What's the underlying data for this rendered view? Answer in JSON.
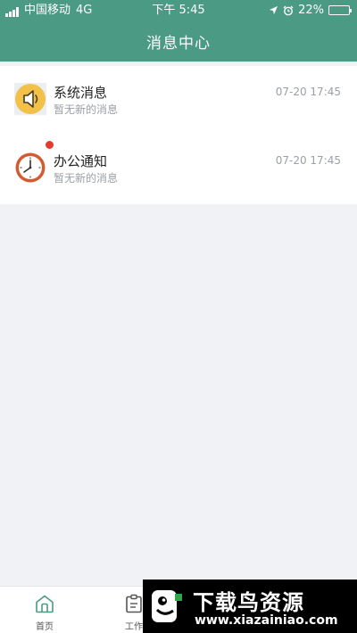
{
  "status_bar": {
    "carrier": "中国移动",
    "network": "4G",
    "time": "下午 5:45",
    "battery": "22%",
    "battery_level": 0.22
  },
  "header": {
    "title": "消息中心"
  },
  "messages": [
    {
      "title": "系统消息",
      "subtitle": "暂无新的消息",
      "time": "07-20 17:45",
      "icon": "speaker-icon",
      "unread": false
    },
    {
      "title": "办公通知",
      "subtitle": "暂无新的消息",
      "time": "07-20 17:45",
      "icon": "clock-icon",
      "unread": true
    }
  ],
  "tabbar": {
    "items": [
      {
        "label": "首页",
        "icon": "home-icon"
      },
      {
        "label": "工作",
        "icon": "clipboard-icon"
      }
    ]
  },
  "watermark": {
    "text": "下载鸟资源",
    "url": "www.xiazainiao.com"
  },
  "colors": {
    "brand": "#4b9a83",
    "badge": "#e53b2c",
    "speaker_bg": "#f2c14a",
    "clock": "#d35b33"
  }
}
